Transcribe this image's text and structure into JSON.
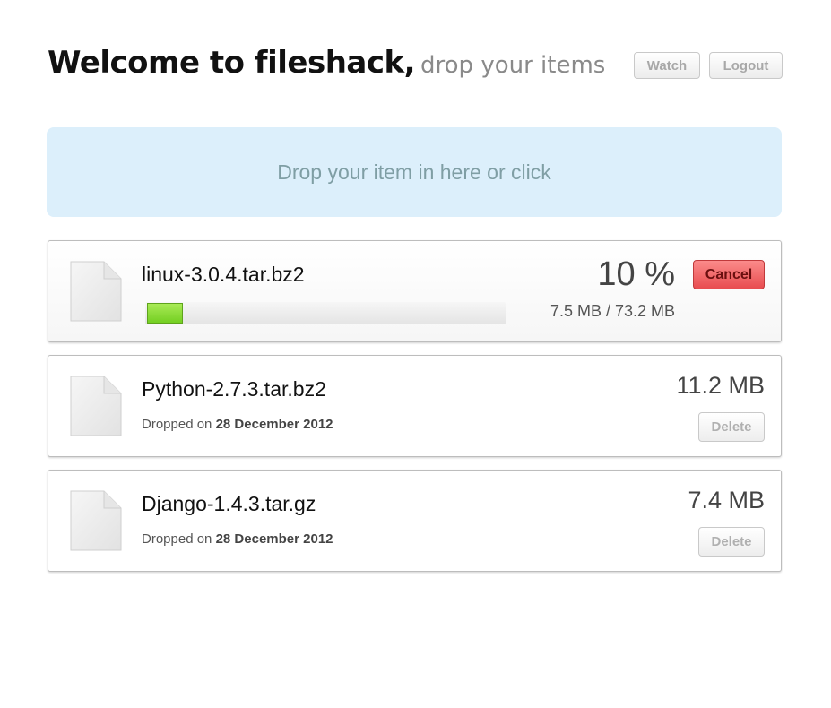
{
  "header": {
    "title": "Welcome to fileshack,",
    "subtitle": "drop your items",
    "watch_label": "Watch",
    "logout_label": "Logout"
  },
  "dropzone": {
    "label": "Drop your item in here or click"
  },
  "uploading": {
    "filename": "linux-3.0.4.tar.bz2",
    "percent_text": "10 %",
    "progress_fraction": 0.1,
    "transfer_text": "7.5 MB / 73.2 MB",
    "cancel_label": "Cancel"
  },
  "items": [
    {
      "filename": "Python-2.7.3.tar.bz2",
      "dropped_prefix": "Dropped on",
      "dropped_date": "28 December 2012",
      "size": "11.2 MB",
      "delete_label": "Delete"
    },
    {
      "filename": "Django-1.4.3.tar.gz",
      "dropped_prefix": "Dropped on",
      "dropped_date": "28 December 2012",
      "size": "7.4 MB",
      "delete_label": "Delete"
    }
  ],
  "icons": {
    "file": "file-icon"
  },
  "colors": {
    "dropzone_bg": "#dceffb",
    "progress_green": "#7ed62c",
    "cancel_red": "#e84c4f"
  }
}
